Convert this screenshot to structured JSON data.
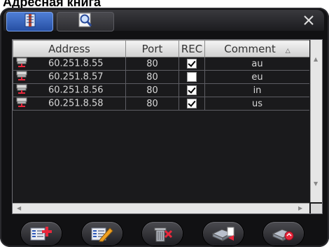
{
  "page_title": "Адресная книга",
  "tabs": [
    {
      "name": "address-book",
      "icon": "book-icon",
      "active": true
    },
    {
      "name": "search",
      "icon": "magnifier-icon",
      "active": false
    }
  ],
  "columns": {
    "address": "Address",
    "port": "Port",
    "rec": "REC",
    "comment": "Comment",
    "comment_sort": "△"
  },
  "rows": [
    {
      "address": "60.251.8.55",
      "port": "80",
      "rec": true,
      "comment": "au"
    },
    {
      "address": "60.251.8.57",
      "port": "80",
      "rec": false,
      "comment": "eu"
    },
    {
      "address": "60.251.8.56",
      "port": "80",
      "rec": true,
      "comment": "in"
    },
    {
      "address": "60.251.8.58",
      "port": "80",
      "rec": true,
      "comment": "us"
    }
  ],
  "buttons": [
    "add-icon",
    "edit-icon",
    "delete-icon",
    "import-icon",
    "export-icon"
  ],
  "colors": {
    "accent": "#2f5fbf",
    "window": "#111113",
    "add": "#e8273c"
  }
}
